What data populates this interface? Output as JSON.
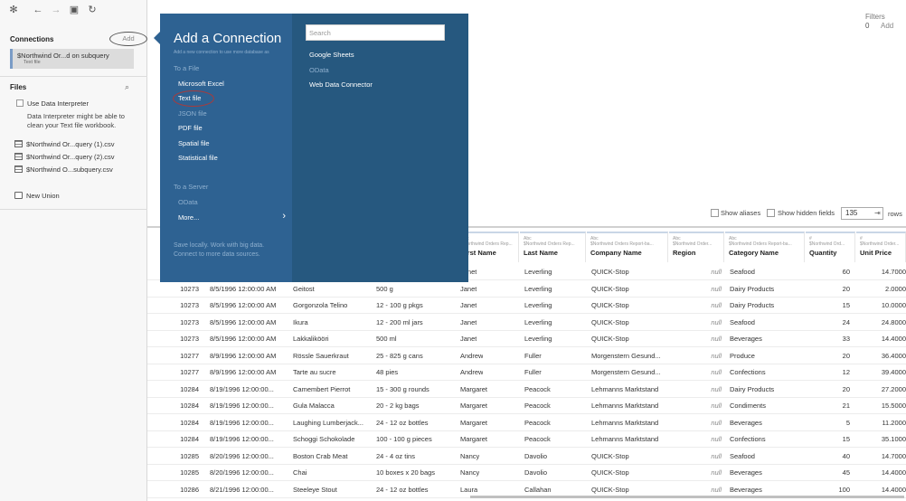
{
  "sidebar": {
    "connections_label": "Connections",
    "add_label": "Add",
    "connection": {
      "name": "$Northwind Or...d on subquery",
      "type": "Text file"
    },
    "files_label": "Files",
    "interpreter_label": "Use Data Interpreter",
    "interpreter_desc": "Data Interpreter might be able to clean your Text file workbook.",
    "files": [
      "$Northwind Or...query (1).csv",
      "$Northwind Or...query (2).csv",
      "$Northwind O...subquery.csv"
    ],
    "new_union_label": "New Union"
  },
  "filters": {
    "label": "Filters",
    "count": "0",
    "add_label": "Add"
  },
  "grid_toolbar": {
    "show_aliases": "Show aliases",
    "show_hidden": "Show hidden fields",
    "rows_value": "135",
    "rows_label": "rows"
  },
  "popup": {
    "title": "Add a Connection",
    "subtitle": "Add a new connection to use more database as",
    "to_a_file": "To a File",
    "file_items": [
      "Microsoft Excel",
      "Text file",
      "JSON file",
      "PDF file",
      "Spatial file",
      "Statistical file"
    ],
    "to_a_server": "To a Server",
    "server_items": [
      "OData"
    ],
    "more_label": "More...",
    "footer": "Save locally. Work with big data. Connect to more data sources.",
    "search_placeholder": "Search",
    "connectors": [
      "Google Sheets",
      "OData",
      "Web Data Connector"
    ]
  },
  "columns": [
    {
      "type": "Abc",
      "source": "$Northwind Orders Rep...",
      "name": "First Name"
    },
    {
      "type": "Abc",
      "source": "$Northwind Orders Rep...",
      "name": "Last Name"
    },
    {
      "type": "Abc",
      "source": "$Northwind Orders Report-ba...",
      "name": "Company Name"
    },
    {
      "type": "Abc",
      "source": "$Northwind Order...",
      "name": "Region"
    },
    {
      "type": "Abc",
      "source": "$Northwind Orders Report-ba...",
      "name": "Category Name"
    },
    {
      "type": "#",
      "source": "$Northwind Ord...",
      "name": "Quantity"
    },
    {
      "type": "#",
      "source": "$Northwind Order...",
      "name": "Unit Price"
    }
  ],
  "rows": [
    [
      "",
      "",
      "",
      "",
      "Janet",
      "Leverling",
      "QUICK-Stop",
      "null",
      "Seafood",
      "60",
      "14.7000"
    ],
    [
      "10273",
      "8/5/1996 12:00:00 AM",
      "Geitost",
      "500 g",
      "Janet",
      "Leverling",
      "QUICK-Stop",
      "null",
      "Dairy Products",
      "20",
      "2.0000"
    ],
    [
      "10273",
      "8/5/1996 12:00:00 AM",
      "Gorgonzola Telino",
      "12 - 100 g pkgs",
      "Janet",
      "Leverling",
      "QUICK-Stop",
      "null",
      "Dairy Products",
      "15",
      "10.0000"
    ],
    [
      "10273",
      "8/5/1996 12:00:00 AM",
      "Ikura",
      "12 - 200 ml jars",
      "Janet",
      "Leverling",
      "QUICK-Stop",
      "null",
      "Seafood",
      "24",
      "24.8000"
    ],
    [
      "10273",
      "8/5/1996 12:00:00 AM",
      "Lakkalikööri",
      "500 ml",
      "Janet",
      "Leverling",
      "QUICK-Stop",
      "null",
      "Beverages",
      "33",
      "14.4000"
    ],
    [
      "10277",
      "8/9/1996 12:00:00 AM",
      "Rössle Sauerkraut",
      "25 - 825 g cans",
      "Andrew",
      "Fuller",
      "Morgenstern Gesund...",
      "null",
      "Produce",
      "20",
      "36.4000"
    ],
    [
      "10277",
      "8/9/1996 12:00:00 AM",
      "Tarte au sucre",
      "48 pies",
      "Andrew",
      "Fuller",
      "Morgenstern Gesund...",
      "null",
      "Confections",
      "12",
      "39.4000"
    ],
    [
      "10284",
      "8/19/1996 12:00:00...",
      "Camembert Pierrot",
      "15 - 300 g rounds",
      "Margaret",
      "Peacock",
      "Lehmanns Marktstand",
      "null",
      "Dairy Products",
      "20",
      "27.2000"
    ],
    [
      "10284",
      "8/19/1996 12:00:00...",
      "Gula Malacca",
      "20 - 2 kg bags",
      "Margaret",
      "Peacock",
      "Lehmanns Marktstand",
      "null",
      "Condiments",
      "21",
      "15.5000"
    ],
    [
      "10284",
      "8/19/1996 12:00:00...",
      "Laughing Lumberjack...",
      "24 - 12 oz bottles",
      "Margaret",
      "Peacock",
      "Lehmanns Marktstand",
      "null",
      "Beverages",
      "5",
      "11.2000"
    ],
    [
      "10284",
      "8/19/1996 12:00:00...",
      "Schoggi Schokolade",
      "100 - 100 g pieces",
      "Margaret",
      "Peacock",
      "Lehmanns Marktstand",
      "null",
      "Confections",
      "15",
      "35.1000"
    ],
    [
      "10285",
      "8/20/1996 12:00:00...",
      "Boston Crab Meat",
      "24 - 4 oz tins",
      "Nancy",
      "Davolio",
      "QUICK-Stop",
      "null",
      "Seafood",
      "40",
      "14.7000"
    ],
    [
      "10285",
      "8/20/1996 12:00:00...",
      "Chai",
      "10 boxes x 20 bags",
      "Nancy",
      "Davolio",
      "QUICK-Stop",
      "null",
      "Beverages",
      "45",
      "14.4000"
    ],
    [
      "10286",
      "8/21/1996 12:00:00...",
      "Steeleye Stout",
      "24 - 12 oz bottles",
      "Laura",
      "Callahan",
      "QUICK-Stop",
      "null",
      "Beverages",
      "100",
      "14.4000"
    ]
  ]
}
